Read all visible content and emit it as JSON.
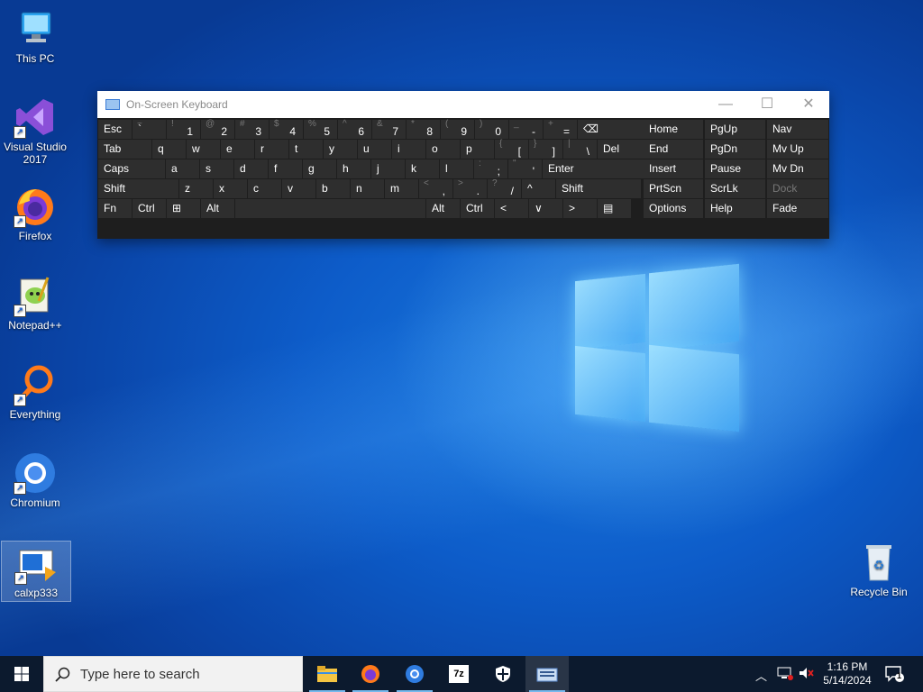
{
  "desktop": {
    "icons": [
      {
        "label": "This PC"
      },
      {
        "label": "Visual Studio 2017"
      },
      {
        "label": "Firefox"
      },
      {
        "label": "Notepad++"
      },
      {
        "label": "Everything"
      },
      {
        "label": "Chromium"
      },
      {
        "label": "calxp333"
      },
      {
        "label": "Recycle Bin"
      }
    ]
  },
  "osk": {
    "title": "On-Screen Keyboard",
    "minimize": "—",
    "maximize": "☐",
    "close": "✕",
    "rows": [
      [
        {
          "m": "Esc"
        },
        {
          "s": "~",
          "m": "`"
        },
        {
          "s": "!",
          "n": "1"
        },
        {
          "s": "@",
          "n": "2"
        },
        {
          "s": "#",
          "n": "3"
        },
        {
          "s": "$",
          "n": "4"
        },
        {
          "s": "%",
          "n": "5"
        },
        {
          "s": "^",
          "n": "6"
        },
        {
          "s": "&",
          "n": "7"
        },
        {
          "s": "*",
          "n": "8"
        },
        {
          "s": "(",
          "n": "9"
        },
        {
          "s": ")",
          "n": "0"
        },
        {
          "s": "_",
          "n": "-"
        },
        {
          "s": "+",
          "n": "="
        },
        {
          "m": "⌫"
        }
      ],
      [
        {
          "m": "Tab"
        },
        {
          "m": "q"
        },
        {
          "m": "w"
        },
        {
          "m": "e"
        },
        {
          "m": "r"
        },
        {
          "m": "t"
        },
        {
          "m": "y"
        },
        {
          "m": "u"
        },
        {
          "m": "i"
        },
        {
          "m": "o"
        },
        {
          "m": "p"
        },
        {
          "s": "{",
          "n": "["
        },
        {
          "s": "}",
          "n": "]"
        },
        {
          "s": "|",
          "n": "\\"
        },
        {
          "m": "Del"
        }
      ],
      [
        {
          "m": "Caps"
        },
        {
          "m": "a"
        },
        {
          "m": "s"
        },
        {
          "m": "d"
        },
        {
          "m": "f"
        },
        {
          "m": "g"
        },
        {
          "m": "h"
        },
        {
          "m": "j"
        },
        {
          "m": "k"
        },
        {
          "m": "l"
        },
        {
          "s": ":",
          "n": ";"
        },
        {
          "s": "\"",
          "n": "'"
        },
        {
          "m": "Enter"
        }
      ],
      [
        {
          "m": "Shift"
        },
        {
          "m": "z"
        },
        {
          "m": "x"
        },
        {
          "m": "c"
        },
        {
          "m": "v"
        },
        {
          "m": "b"
        },
        {
          "m": "n"
        },
        {
          "m": "m"
        },
        {
          "s": "<",
          "n": ","
        },
        {
          "s": ">",
          "n": "."
        },
        {
          "s": "?",
          "n": "/"
        },
        {
          "m": "^"
        },
        {
          "m": "Shift"
        }
      ],
      [
        {
          "m": "Fn"
        },
        {
          "m": "Ctrl"
        },
        {
          "m": "⊞"
        },
        {
          "m": "Alt"
        },
        {
          "m": ""
        },
        {
          "m": "Alt"
        },
        {
          "m": "Ctrl"
        },
        {
          "m": "<"
        },
        {
          "m": "∨"
        },
        {
          "m": ">"
        },
        {
          "m": "▤"
        }
      ]
    ],
    "nav_rows": [
      [
        "Home",
        "PgUp",
        "Nav"
      ],
      [
        "End",
        "PgDn",
        "Mv Up"
      ],
      [
        "Insert",
        "Pause",
        "Mv Dn"
      ],
      [
        "PrtScn",
        "ScrLk",
        "Dock"
      ],
      [
        "Options",
        "Help",
        "Fade"
      ]
    ]
  },
  "taskbar": {
    "search_placeholder": "Type here to search",
    "apps": [
      "file-explorer",
      "firefox",
      "chromium",
      "7zip",
      "security",
      "osk"
    ],
    "time": "1:16 PM",
    "date": "5/14/2024",
    "notification_count": "1"
  }
}
